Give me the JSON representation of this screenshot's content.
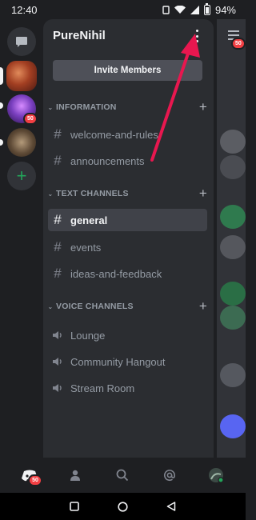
{
  "status_bar": {
    "time": "12:40",
    "battery": "94%"
  },
  "server": {
    "name": "PureNihil",
    "invite_label": "Invite Members"
  },
  "rail": {
    "server_badge": "50"
  },
  "categories": [
    {
      "name": "INFORMATION",
      "channels": [
        "welcome-and-rules",
        "announcements"
      ]
    },
    {
      "name": "TEXT CHANNELS",
      "channels": [
        "general",
        "events",
        "ideas-and-feedback"
      ]
    },
    {
      "name": "VOICE CHANNELS",
      "channels": [
        "Lounge",
        "Community Hangout",
        "Stream Room"
      ]
    }
  ],
  "active_channel": "general",
  "peek": {
    "badge": "50"
  },
  "bottom_nav": {
    "home_badge": "50"
  },
  "colors": {
    "background": "#1e1f22",
    "panel": "#2b2d31",
    "active": "#404249",
    "badge": "#f23f43",
    "add_server": "#23a55a",
    "annotation_arrow": "#e8174f"
  },
  "icons": [
    "wifi-icon",
    "battery-icon",
    "dm-icon",
    "add-server-icon",
    "more-options-icon",
    "hash-icon",
    "speaker-icon",
    "hamburger-icon",
    "home-icon",
    "friends-icon",
    "search-icon",
    "mentions-icon",
    "profile-icon",
    "back-icon",
    "home-circle-icon",
    "recents-icon"
  ]
}
